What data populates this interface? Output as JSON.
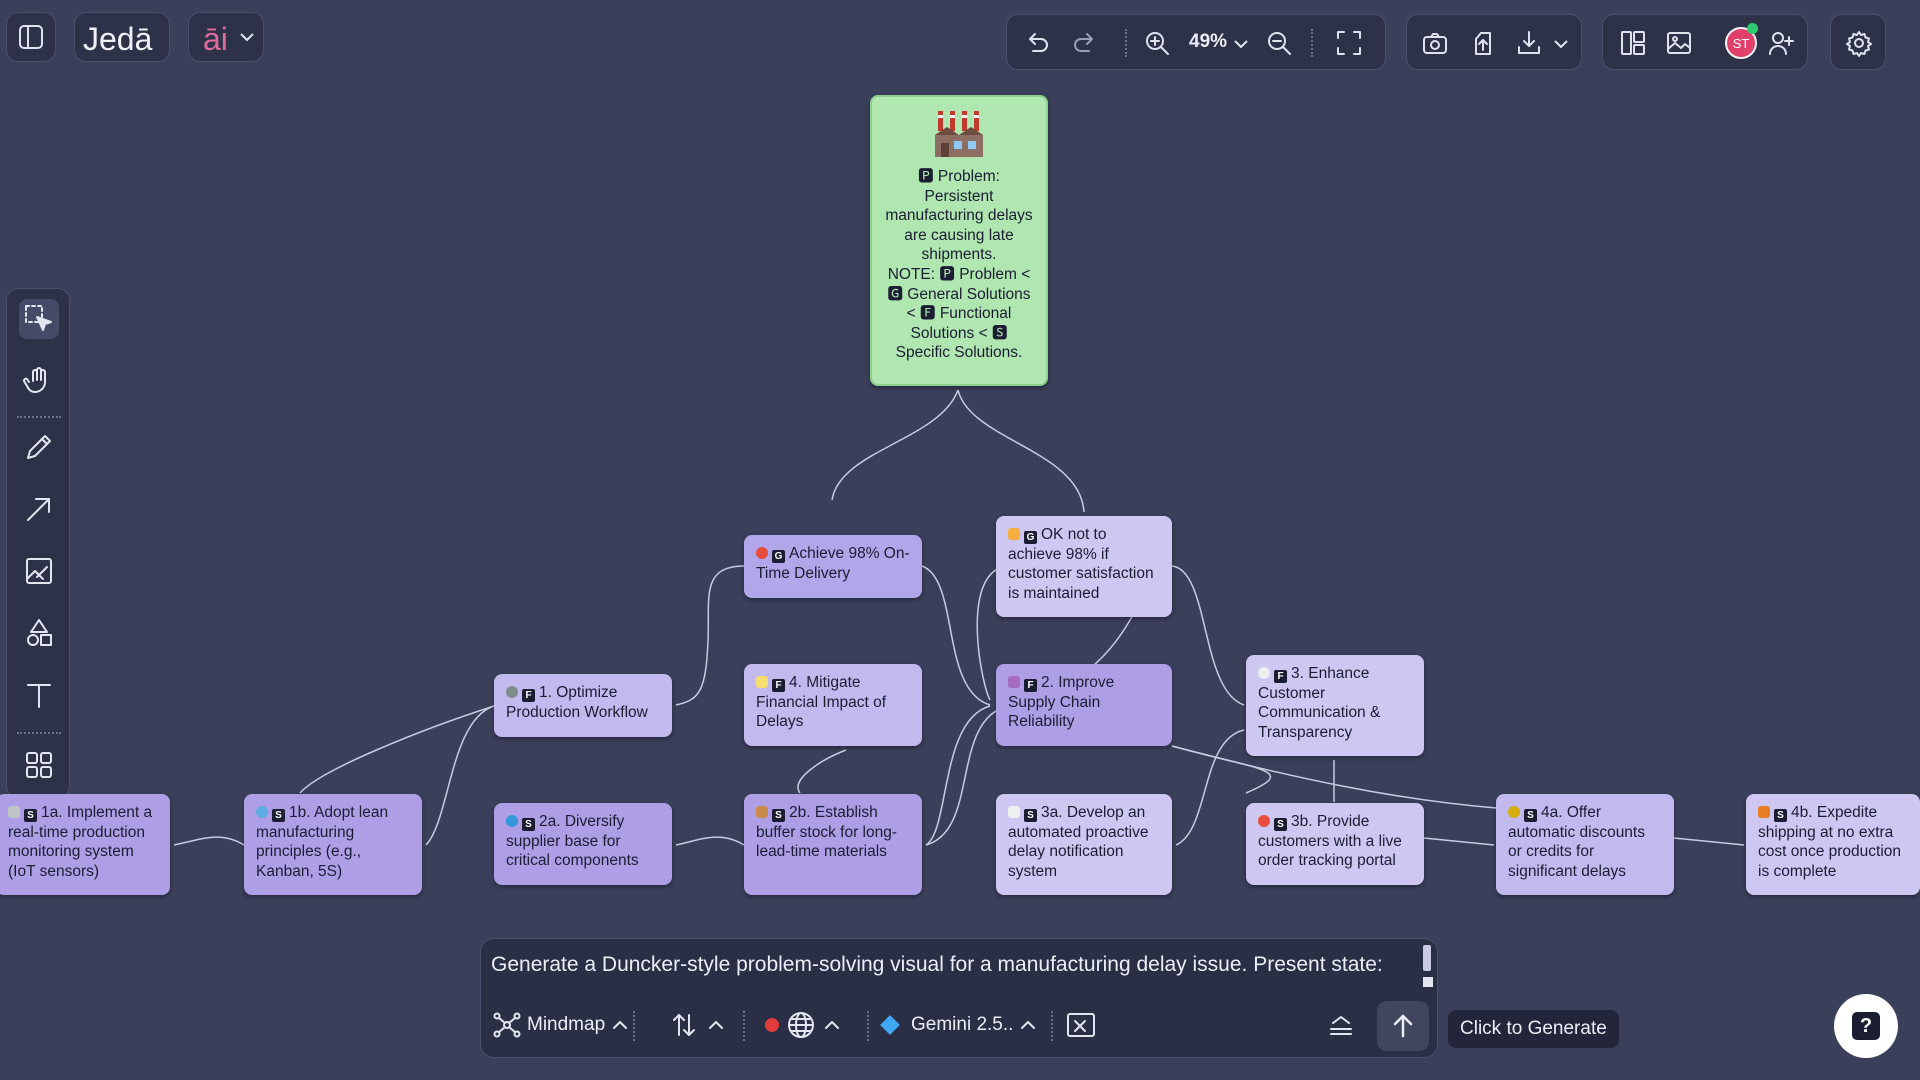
{
  "app": {
    "brand": "Jedā",
    "ai_label": "āi",
    "zoom": "49%",
    "avatar_initials": "ST"
  },
  "colors": {
    "background": "#3a3f5a",
    "root_node": "#b0e6b0",
    "node": "#b8aee8",
    "avatar": "#e0406a",
    "online_dot": "#2ecc71"
  },
  "toolbar_icons": [
    "undo-icon",
    "redo-icon",
    "zoom-in-icon",
    "zoom-out-icon",
    "fit-screen-icon",
    "camera-icon",
    "share-icon",
    "download-icon",
    "layout-icon",
    "image-icon",
    "add-user-icon",
    "gear-icon"
  ],
  "left_tools": [
    "select-icon",
    "hand-icon",
    "pen-icon",
    "arrow-icon",
    "image-frame-icon",
    "shapes-icon",
    "text-icon",
    "grid-icon"
  ],
  "mindmap": {
    "root": {
      "emoji": "🏭",
      "lines": [
        "🅿 Problem:",
        "Persistent",
        "manufacturing delays",
        "are causing late",
        "shipments.",
        "NOTE: 🅿 Problem <",
        "🅶 General Solutions",
        "< 🅵 Functional",
        "Solutions < 🆂",
        "Specific Solutions."
      ]
    },
    "nodes": [
      {
        "id": "g1",
        "tag": "G",
        "text": "Achieve 98% On-Time Delivery"
      },
      {
        "id": "g2",
        "tag": "G",
        "text": "OK not to achieve 98% if customer satisfaction is maintained"
      },
      {
        "id": "f1",
        "tag": "F",
        "text": "1. Optimize Production Workflow"
      },
      {
        "id": "f4",
        "tag": "F",
        "text": "4. Mitigate Financial Impact of Delays"
      },
      {
        "id": "f2",
        "tag": "F",
        "text": "2. Improve Supply Chain Reliability"
      },
      {
        "id": "f3",
        "tag": "F",
        "text": "3. Enhance Customer Communication & Transparency"
      },
      {
        "id": "s1a",
        "tag": "S",
        "text": "1a. Implement a real-time production monitoring system (IoT sensors)"
      },
      {
        "id": "s1b",
        "tag": "S",
        "text": "1b. Adopt lean manufacturing principles (e.g., Kanban, 5S)"
      },
      {
        "id": "s2a",
        "tag": "S",
        "text": "2a. Diversify supplier base for critical components"
      },
      {
        "id": "s2b",
        "tag": "S",
        "text": "2b. Establish buffer stock for long-lead-time materials"
      },
      {
        "id": "s3a",
        "tag": "S",
        "text": "3a. Develop an automated proactive delay notification system"
      },
      {
        "id": "s3b",
        "tag": "S",
        "text": "3b. Provide customers with a live order tracking portal"
      },
      {
        "id": "s4a",
        "tag": "S",
        "text": "4a. Offer automatic discounts or credits for significant delays"
      },
      {
        "id": "s4b",
        "tag": "S",
        "text": "4b. Expedite shipping at no extra cost once production is complete"
      }
    ]
  },
  "prompt": {
    "text": "Generate a Duncker-style problem-solving visual for a manufacturing delay issue. Present state:",
    "mode": "Mindmap",
    "model": "Gemini 2.5..",
    "generate_tooltip": "Click to Generate"
  },
  "help_label": "?"
}
